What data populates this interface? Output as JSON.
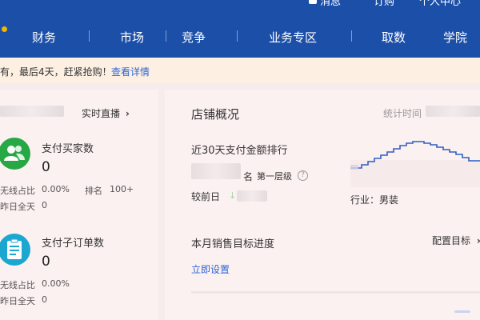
{
  "top_links": [
    "消息",
    "订购",
    "个人中心"
  ],
  "nav": [
    "财务",
    "市场",
    "竞争",
    "业务专区",
    "取数",
    "学院"
  ],
  "notice": {
    "text": "有，最后4天，赶紧抢购！",
    "link": "查看详情"
  },
  "left": {
    "live_label": "实时直播",
    "live_chevron": "›",
    "metrics": [
      {
        "title": "支付买家数",
        "value": "0",
        "rows": [
          {
            "label": "无线占比",
            "value": "0.00%",
            "rank_label": "排名",
            "rank_value": "100+"
          },
          {
            "label": "昨日全天",
            "value": "0"
          }
        ],
        "color": "#28a745",
        "icon": "user-group-icon"
      },
      {
        "title": "支付子订单数",
        "value": "0",
        "rows": [
          {
            "label": "无线占比",
            "value": "0.00%"
          },
          {
            "label": "昨日全天",
            "value": "0"
          }
        ],
        "color": "#1ba7cf",
        "icon": "clipboard-list-icon"
      }
    ]
  },
  "main": {
    "title": "店铺概况",
    "stat_time_label": "统计时间",
    "rank_title": "近30天支付金额排行",
    "rank_unit": "名",
    "rank_level": "第一层级",
    "help_icon": "?",
    "compare_label": "较前日",
    "compare_arrow": "↓",
    "industry": "行业：男装",
    "progress_title": "本月销售目标进度",
    "config_label": "配置目标",
    "config_chevron": "›",
    "set_now": "立即设置"
  },
  "colors": {
    "nav_bg": "#1c4fa8",
    "link": "#2b66d9",
    "chart_line": "#2e5fc4",
    "buyers_icon": "#28a745",
    "orders_icon": "#1ba7cf"
  }
}
